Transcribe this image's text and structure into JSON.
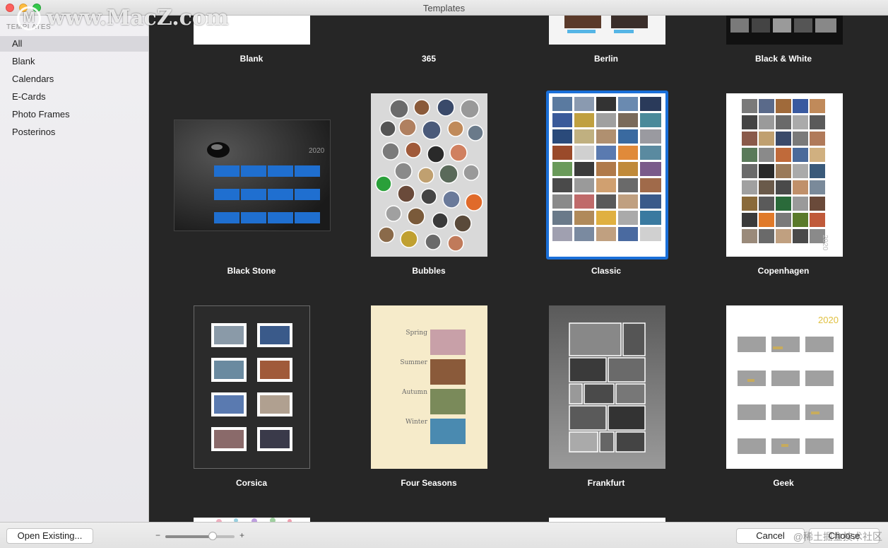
{
  "window": {
    "title": "Templates"
  },
  "watermark": {
    "logo": "M",
    "text": "www.MacZ.com"
  },
  "sidebar": {
    "heading": "TEMPLATES",
    "items": [
      {
        "label": "All",
        "selected": true
      },
      {
        "label": "Blank",
        "selected": false
      },
      {
        "label": "Calendars",
        "selected": false
      },
      {
        "label": "E-Cards",
        "selected": false
      },
      {
        "label": "Photo Frames",
        "selected": false
      },
      {
        "label": "Posterinos",
        "selected": false
      }
    ]
  },
  "templates": {
    "row1": [
      "Blank",
      "365",
      "Berlin",
      "Black & White"
    ],
    "row2": [
      "Black Stone",
      "Bubbles",
      "Classic",
      "Copenhagen"
    ],
    "row3": [
      "Corsica",
      "Four Seasons",
      "Frankfurt",
      "Geek"
    ],
    "selected": "Classic"
  },
  "thumbs": {
    "black_stone_year": "2020",
    "copenhagen_year": "2020",
    "geek_year": "2020",
    "seasons": [
      "Spring",
      "Summer",
      "Autumn",
      "Winter"
    ]
  },
  "bottom": {
    "open_existing": "Open Existing...",
    "zoom_minus": "−",
    "zoom_plus": "+",
    "zoom_level": 0.68,
    "cancel": "Cancel",
    "choose": "Choose",
    "watermark_text": "@稀土掘金技术社区"
  },
  "colors": {
    "selection_border": "#1a6fd8",
    "content_bg": "#262626",
    "sidebar_bg": "#eeedf0"
  }
}
